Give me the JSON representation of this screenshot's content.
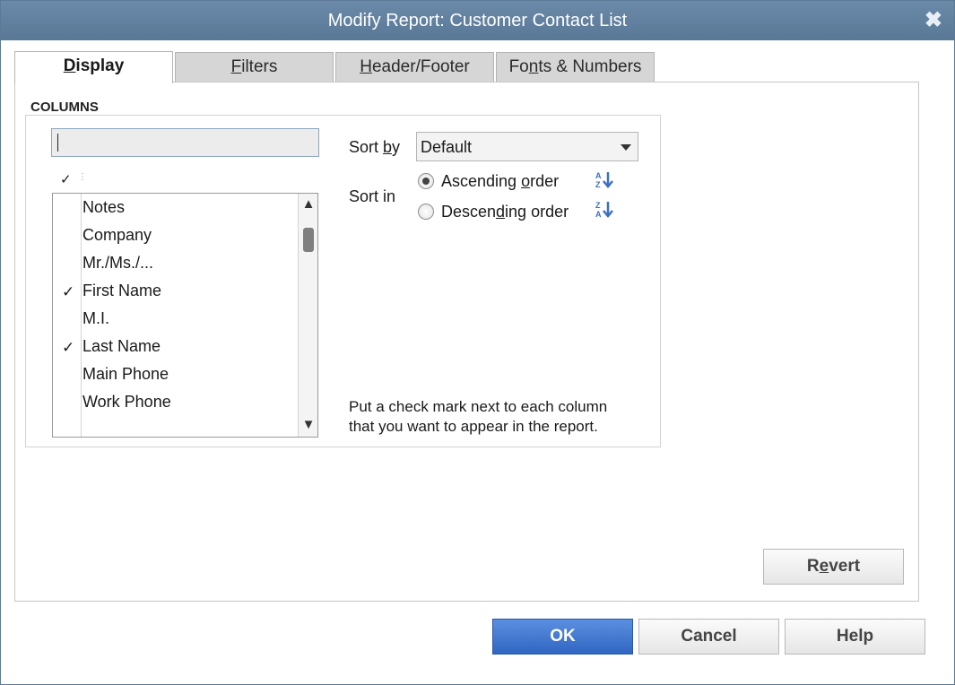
{
  "window": {
    "title": "Modify Report: Customer Contact List",
    "close_glyph": "✖"
  },
  "tabs": [
    {
      "pre": "",
      "key": "D",
      "post": "isplay",
      "active": true
    },
    {
      "pre": "",
      "key": "F",
      "post": "ilters",
      "active": false
    },
    {
      "pre": "",
      "key": "H",
      "post": "eader/Footer",
      "active": false
    },
    {
      "pre": "Fo",
      "key": "n",
      "post": "ts & Numbers",
      "active": false
    }
  ],
  "columns": {
    "legend": "COLUMNS",
    "search_value": "",
    "header_check": "✓",
    "header_dots": "⋮",
    "items": [
      {
        "label": "Notes",
        "checked": false
      },
      {
        "label": "Company",
        "checked": false
      },
      {
        "label": "Mr./Ms./...",
        "checked": false
      },
      {
        "label": "First Name",
        "checked": true
      },
      {
        "label": "M.I.",
        "checked": false
      },
      {
        "label": "Last Name",
        "checked": true
      },
      {
        "label": "Main Phone",
        "checked": false
      },
      {
        "label": "Work Phone",
        "checked": false
      }
    ],
    "check_glyph": "✓",
    "scroll_up_glyph": "▲",
    "scroll_down_glyph": "▼"
  },
  "sort": {
    "by_label_pre": "Sort ",
    "by_label_key": "b",
    "by_label_post": "y",
    "by_value": "Default",
    "in_label": "Sort in",
    "ascending": {
      "pre": "Ascending ",
      "key": "o",
      "post": "rder",
      "selected": true
    },
    "descending": {
      "pre": "Descen",
      "key": "d",
      "post": "ing order",
      "selected": false
    },
    "ascending_icon_text": "AZ",
    "descending_icon_text": "ZA"
  },
  "hint": {
    "line1": "Put a check mark next to each column",
    "line2": "that you want to appear in the report."
  },
  "buttons": {
    "revert": {
      "pre": "R",
      "key": "e",
      "post": "vert"
    },
    "ok": "OK",
    "cancel": "Cancel",
    "help": "Help"
  },
  "colors": {
    "titlebar": "#5f7f9e",
    "primary_button": "#3d74d0",
    "icon_blue": "#3a6fc4"
  }
}
